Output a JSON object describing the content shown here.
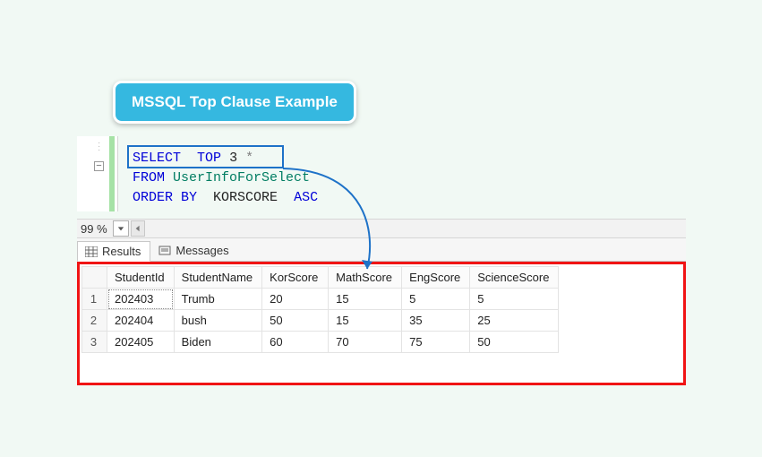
{
  "callout": {
    "text": "MSSQL Top Clause Example"
  },
  "sql": {
    "line1": {
      "select": "SELECT",
      "top": "TOP",
      "num": "3",
      "star": "*"
    },
    "line2": {
      "from": "FROM",
      "table": "UserInfoForSelect"
    },
    "line3": {
      "orderby": "ORDER BY",
      "col": "KORSCORE",
      "dir": "ASC"
    }
  },
  "zoom": {
    "label": "99 %"
  },
  "tabs": {
    "results": "Results",
    "messages": "Messages"
  },
  "grid": {
    "columns": [
      "StudentId",
      "StudentName",
      "KorScore",
      "MathScore",
      "EngScore",
      "ScienceScore"
    ],
    "rows": [
      {
        "n": "1",
        "StudentId": "202403",
        "StudentName": "Trumb",
        "KorScore": "20",
        "MathScore": "15",
        "EngScore": "5",
        "ScienceScore": "5"
      },
      {
        "n": "2",
        "StudentId": "202404",
        "StudentName": "bush",
        "KorScore": "50",
        "MathScore": "15",
        "EngScore": "35",
        "ScienceScore": "25"
      },
      {
        "n": "3",
        "StudentId": "202405",
        "StudentName": "Biden",
        "KorScore": "60",
        "MathScore": "70",
        "EngScore": "75",
        "ScienceScore": "50"
      }
    ]
  }
}
